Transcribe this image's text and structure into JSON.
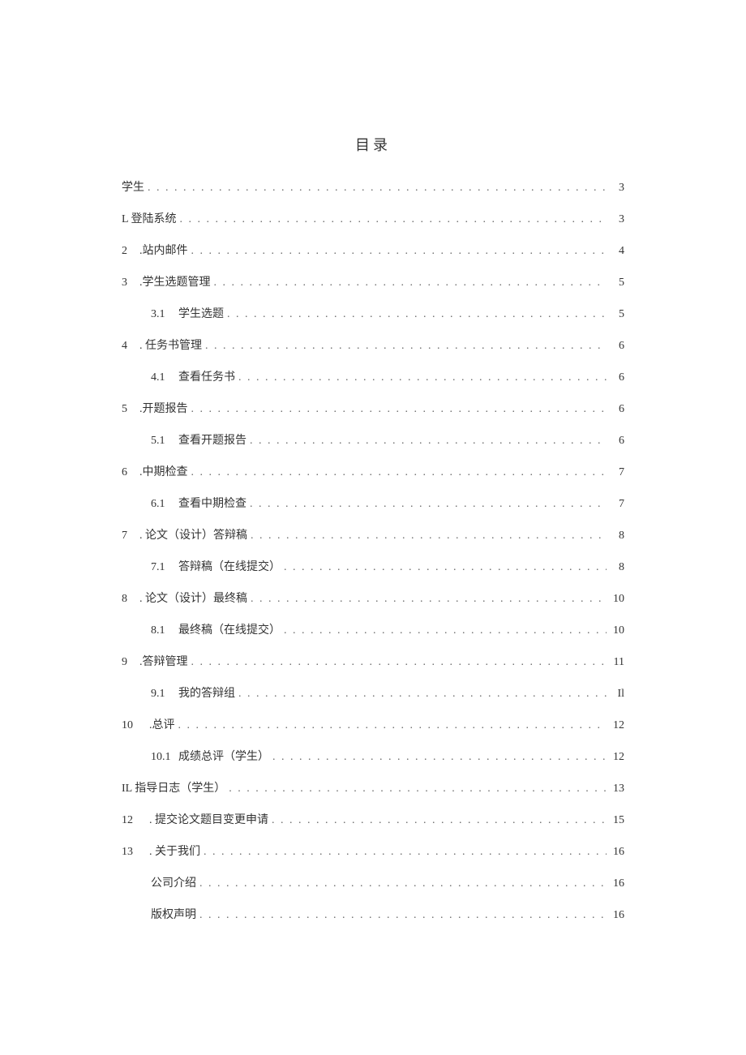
{
  "title": "目录",
  "entries": [
    {
      "level": 0,
      "num": "",
      "label": "学生",
      "page": "3"
    },
    {
      "level": 0,
      "num": "",
      "label": "L 登陆系统",
      "page": "3"
    },
    {
      "level": 1,
      "num": "2",
      "label": ".站内邮件",
      "page": "4"
    },
    {
      "level": 1,
      "num": "3",
      "label": ".学生选题管理",
      "page": "5"
    },
    {
      "level": 2,
      "num": "3.1",
      "label": "学生选题",
      "page": "5"
    },
    {
      "level": 1,
      "num": "4",
      "label": ". 任务书管理",
      "page": "6"
    },
    {
      "level": 2,
      "num": "4.1",
      "label": "查看任务书",
      "page": "6"
    },
    {
      "level": 1,
      "num": "5",
      "label": ".开题报告",
      "page": "6"
    },
    {
      "level": 2,
      "num": "5.1",
      "label": "查看开题报告",
      "page": "6"
    },
    {
      "level": 1,
      "num": "6",
      "label": ".中期检查",
      "page": "7"
    },
    {
      "level": 2,
      "num": "6.1",
      "label": "查看中期检查",
      "page": "7"
    },
    {
      "level": 1,
      "num": "7",
      "label": ". 论文（设计）答辩稿",
      "page": "8"
    },
    {
      "level": 2,
      "num": "7.1",
      "label": "答辩稿（在线提交）",
      "page": "8"
    },
    {
      "level": 1,
      "num": "8",
      "label": ". 论文（设计）最终稿",
      "page": "10"
    },
    {
      "level": 2,
      "num": "8.1",
      "label": "最终稿（在线提交）",
      "page": "10"
    },
    {
      "level": 1,
      "num": "9",
      "label": ".答辩管理",
      "page": "11"
    },
    {
      "level": 2,
      "num": "9.1",
      "label": "我的答辩组",
      "page": "Il"
    },
    {
      "level": 1,
      "num": "10",
      "label": ".总评",
      "page": "12"
    },
    {
      "level": 2,
      "num": "10.1",
      "label": "成绩总评（学生）",
      "page": "12"
    },
    {
      "level": 0,
      "num": "",
      "label": "IL 指导日志（学生）",
      "page": "13"
    },
    {
      "level": 1,
      "num": "12",
      "label": ". 提交论文题目变更申请",
      "page": "15"
    },
    {
      "level": 1,
      "num": "13",
      "label": ". 关于我们",
      "page": "16"
    },
    {
      "level": 2,
      "num": "",
      "label": "公司介绍",
      "page": "16"
    },
    {
      "level": 2,
      "num": "",
      "label": "版权声明",
      "page": "16"
    }
  ]
}
